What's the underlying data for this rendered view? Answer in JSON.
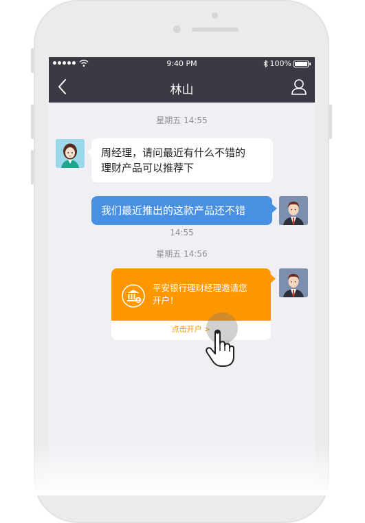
{
  "status_bar": {
    "time": "9:40 PM",
    "battery": "100%"
  },
  "nav": {
    "title": "林山"
  },
  "messages": [
    {
      "timestamp": "星期五 14:55"
    },
    {
      "text_line1": "周经理，请问最近有什么不错的",
      "text_line2": "理财产品可以推荐下"
    },
    {
      "text": "我们最近推出的这款产品还不错",
      "time": "14:55"
    },
    {
      "timestamp": "星期五 14:56"
    }
  ],
  "card": {
    "text_line1": "平安银行理财经理邀请您",
    "text_line2": "开户！",
    "action": "点击开户 >"
  },
  "colors": {
    "nav": "#3a3a45",
    "accent_blue": "#4a90e2",
    "accent_orange": "#ff9700",
    "bg": "#efeff4"
  }
}
